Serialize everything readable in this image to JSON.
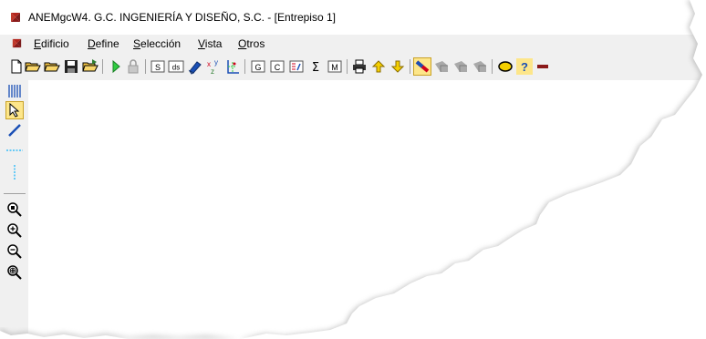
{
  "window": {
    "title": "ANEMgcW4. G.C. INGENIERÍA Y DISEÑO, S.C. - [Entrepiso 1]"
  },
  "menu": [
    {
      "accel": "E",
      "rest": "dificio"
    },
    {
      "accel": "D",
      "rest": "efine"
    },
    {
      "accel": "S",
      "rest": "elección"
    },
    {
      "accel": "V",
      "rest": "ista"
    },
    {
      "accel": "O",
      "rest": "tros"
    }
  ],
  "toolbar": {
    "s_label": "S",
    "ds_label": "ds",
    "g_label": "G",
    "c_label": "C",
    "sigma_label": "Σ",
    "m_label": "M",
    "help_label": "?"
  },
  "colors": {
    "chrome": "#f0f0f0",
    "highlight": "#fde68a",
    "accent_red": "#8b1a1a"
  }
}
